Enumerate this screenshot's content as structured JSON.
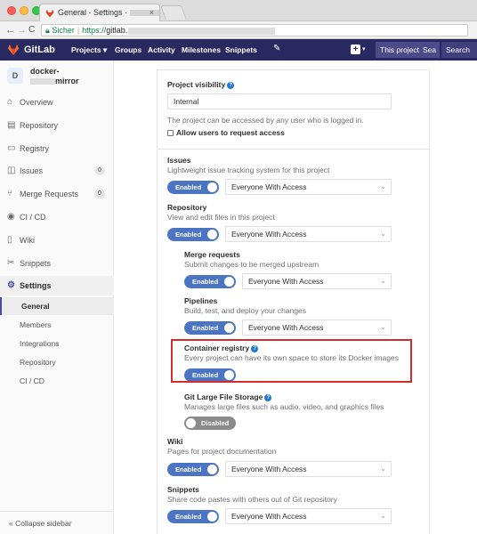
{
  "browser": {
    "tab_title": "General · Settings ·",
    "tab_close": "×",
    "url_secure": "Sicher",
    "url_scheme": "https://",
    "url_host": "gitlab.",
    "back": "←",
    "forward": "→",
    "reload": "C"
  },
  "header": {
    "brand": "GitLab",
    "nav": [
      "Projects",
      "Groups",
      "Activity",
      "Milestones",
      "Snippets"
    ],
    "this_project": "This project",
    "search_input": "Sea",
    "search": "Search",
    "plus": "+",
    "caret": "▾",
    "projects_caret": "▾",
    "wrench": "✎"
  },
  "sidebar": {
    "avatar": "D",
    "project_line1": "docker-",
    "project_line2": "mirror",
    "items": [
      {
        "label": "Overview",
        "icon": "home-icon",
        "glyph": "⌂"
      },
      {
        "label": "Repository",
        "icon": "repo-icon",
        "glyph": "▤"
      },
      {
        "label": "Registry",
        "icon": "registry-icon",
        "glyph": "▭"
      },
      {
        "label": "Issues",
        "icon": "issues-icon",
        "glyph": "◫",
        "count": "0"
      },
      {
        "label": "Merge Requests",
        "icon": "merge-icon",
        "glyph": "⑂",
        "count": "0"
      },
      {
        "label": "CI / CD",
        "icon": "rocket-icon",
        "glyph": "◉"
      },
      {
        "label": "Wiki",
        "icon": "book-icon",
        "glyph": "▯"
      },
      {
        "label": "Snippets",
        "icon": "scissors-icon",
        "glyph": "✂"
      },
      {
        "label": "Settings",
        "icon": "gear-icon",
        "glyph": "⚙"
      }
    ],
    "sub_items": [
      "General",
      "Members",
      "Integrations",
      "Repository",
      "CI / CD"
    ],
    "collapse": "Collapse sidebar",
    "collapse_glyph": "«"
  },
  "settings": {
    "visibility_label": "Project visibility",
    "visibility_value": "Internal",
    "visibility_desc": "The project can be accessed by any user who is logged in.",
    "allow_request": "Allow users to request access",
    "issues_label": "Issues",
    "issues_desc": "Lightweight issue tracking system for this project",
    "repository_label": "Repository",
    "repository_desc": "View and edit files in this project",
    "mr_label": "Merge requests",
    "mr_desc": "Submit changes to be merged upstream",
    "pipelines_label": "Pipelines",
    "pipelines_desc": "Build, test, and deploy your changes",
    "registry_label": "Container registry",
    "registry_desc": "Every project can have its own space to store its Docker images",
    "lfs_label": "Git Large File Storage",
    "lfs_desc": "Manages large files such as audio, video, and graphics files",
    "wiki_label": "Wiki",
    "wiki_desc": "Pages for project documentation",
    "snippets_label": "Snippets",
    "snippets_desc": "Share code pastes with others out of Git repository",
    "enabled": "Enabled",
    "disabled": "Disabled",
    "access": "Everyone With Access",
    "help": "?",
    "chevron": "⌄"
  },
  "colors": {
    "header_bg": "#292961",
    "toggle_on": "#4b74c3",
    "toggle_off": "#8a8a8a",
    "highlight": "#d62b2b"
  }
}
